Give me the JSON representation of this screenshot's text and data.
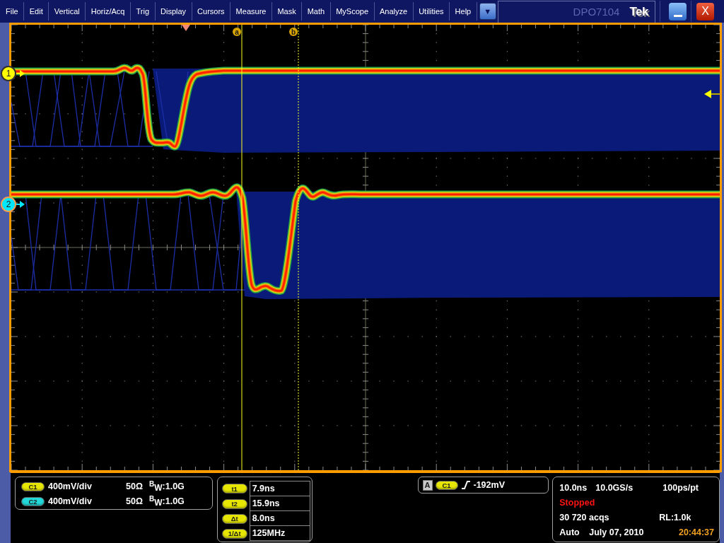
{
  "menu_bar": {
    "items": [
      "File",
      "Edit",
      "Vertical",
      "Horiz/Acq",
      "Trig",
      "Display",
      "Cursors",
      "Measure",
      "Mask",
      "Math",
      "MyScope",
      "Analyze",
      "Utilities",
      "Help"
    ],
    "more_button": "▼"
  },
  "title_bar": {
    "model": "DPO7104",
    "logo": "Tek",
    "close_button": "X"
  },
  "display": {
    "channels": [
      {
        "label": "1",
        "color": "#ffff00",
        "selected": false
      },
      {
        "label": "2",
        "color": "#00e8ff",
        "selected": true
      }
    ],
    "cursors": [
      {
        "label": "a",
        "kind": "solid"
      },
      {
        "label": "b",
        "kind": "dotted"
      }
    ]
  },
  "vertical_readout": {
    "rows": [
      {
        "channel": "C1",
        "color": "#e6e600",
        "scale": "400mV/div",
        "termination": "50Ω",
        "bandwidth": "$^{B}$$_{W}$:1.0G"
      },
      {
        "channel": "C2",
        "color": "#22d8d8",
        "scale": "400mV/div",
        "termination": "50Ω",
        "bandwidth": "$^{B}$$_{W}$:1.0G"
      }
    ]
  },
  "cursor_readout": {
    "rows": [
      {
        "label": "t1",
        "value": "7.9ns"
      },
      {
        "label": "t2",
        "value": "15.9ns"
      },
      {
        "label": "Δt",
        "value": "8.0ns"
      },
      {
        "label": "1/Δt",
        "value": "125MHz"
      }
    ]
  },
  "trigger_readout": {
    "sequence": "A",
    "source": "C1",
    "level": "-192mV"
  },
  "acquisition_readout": {
    "time_scale": "10.0ns",
    "sample_rate": "10.0GS/s",
    "resolution": "100ps/pt",
    "status": "Stopped",
    "acquisitions": "30 720 acqs",
    "record_length": "RL:1.0k",
    "trigger_mode": "Auto",
    "date": "July 07, 2010",
    "time": "20:44:37"
  }
}
